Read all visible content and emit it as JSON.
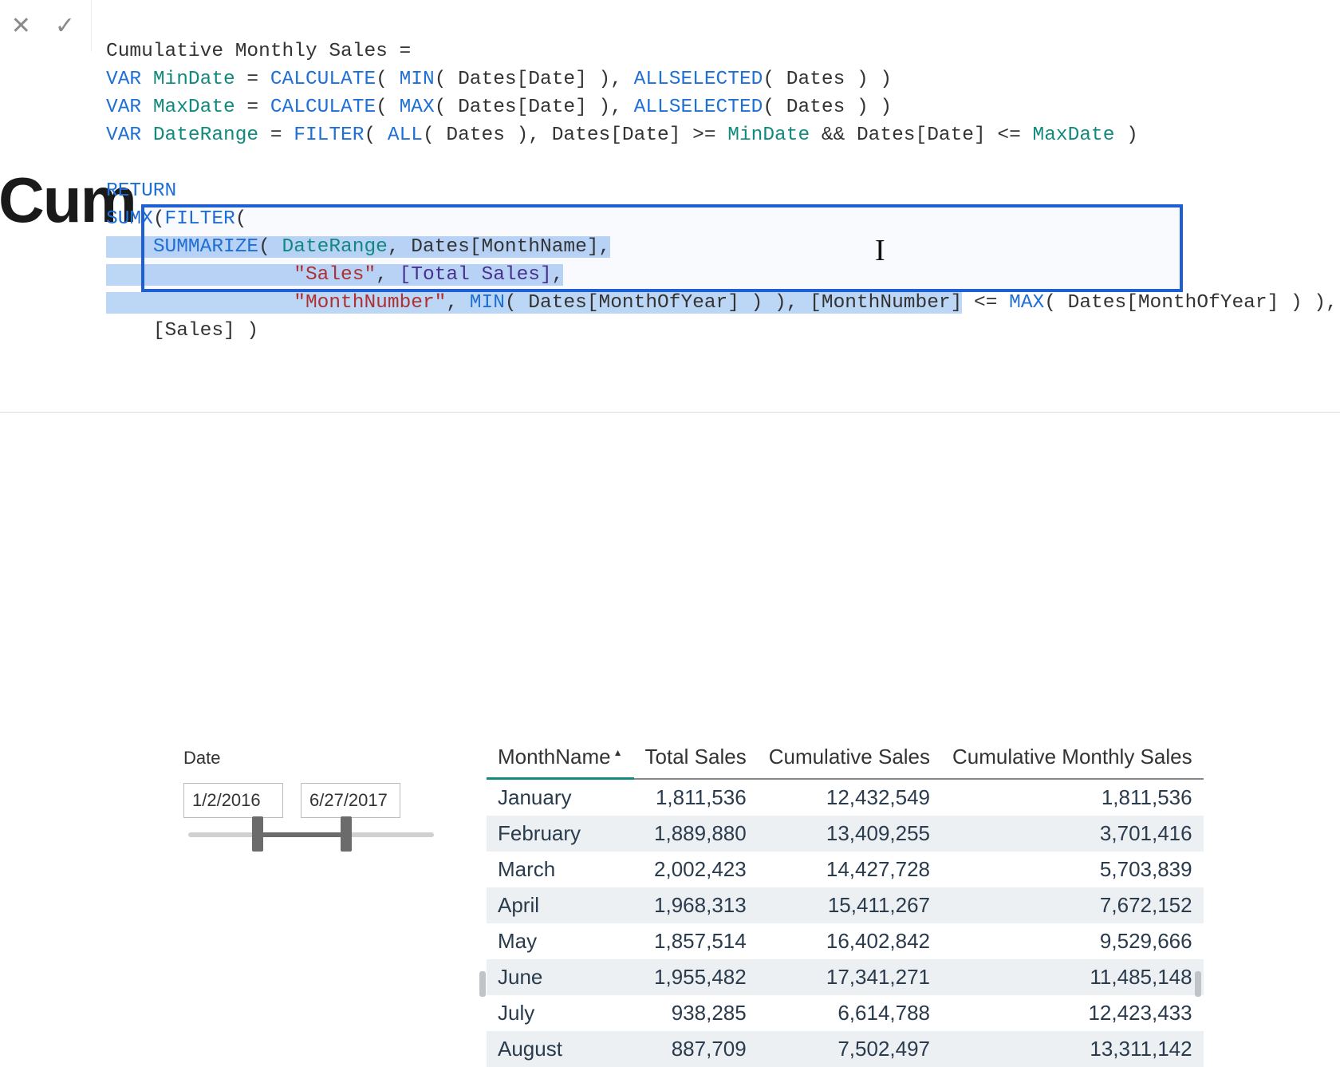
{
  "title_fragment": "Cum",
  "formula": {
    "line1": "Cumulative Monthly Sales =",
    "l2_pre": "VAR ",
    "l2_name": "MinDate",
    "l2_eq": " = ",
    "l2_fn1": "CALCULATE",
    "l2_mid1": "( ",
    "l2_fn2": "MIN",
    "l2_mid2": "( Dates[Date] ), ",
    "l2_fn3": "ALLSELECTED",
    "l2_end": "( Dates ) )",
    "l3_pre": "VAR ",
    "l3_name": "MaxDate",
    "l3_eq": " = ",
    "l3_fn1": "CALCULATE",
    "l3_mid1": "( ",
    "l3_fn2": "MAX",
    "l3_mid2": "( Dates[Date] ), ",
    "l3_fn3": "ALLSELECTED",
    "l3_end": "( Dates ) )",
    "l4_pre": "VAR ",
    "l4_name": "DateRange",
    "l4_eq": " = ",
    "l4_fn1": "FILTER",
    "l4_mid1": "( ",
    "l4_fn2": "ALL",
    "l4_mid2": "( Dates ), Dates[Date] >= ",
    "l4_v1": "MinDate",
    "l4_mid3": " && Dates[Date] <= ",
    "l4_v2": "MaxDate",
    "l4_end": " )",
    "l5_blank": " ",
    "l6": "RETURN",
    "l7_fn1": "SUMX",
    "l7_mid": "(",
    "l7_fn2": "FILTER",
    "l7_end": "(",
    "l8_indent": "    ",
    "l8_fn": "SUMMARIZE",
    "l8_mid1": "( ",
    "l8_var": "DateRange",
    "l8_mid2": ", Dates[MonthName],",
    "l9_indent": "                ",
    "l9_str": "\"Sales\"",
    "l9_mid": ", ",
    "l9_meas": "[Total Sales]",
    "l9_end": ",",
    "l10_indent": "                ",
    "l10_str": "\"MonthNumber\"",
    "l10_mid1": ", ",
    "l10_fn1": "MIN",
    "l10_mid2": "( Dates[MonthOfYear] ) ), [MonthNumber]",
    "l10_mid3": " <= ",
    "l10_fn2": "MAX",
    "l10_end": "( Dates[MonthOfYear] ) ),",
    "l11_indent": "    ",
    "l11_txt": "[Sales] )"
  },
  "slicer": {
    "label": "Date",
    "from": "1/2/2016",
    "to": "6/27/2017"
  },
  "table": {
    "columns": [
      "MonthName",
      "Total Sales",
      "Cumulative Sales",
      "Cumulative Monthly Sales"
    ],
    "rows": [
      [
        "January",
        "1,811,536",
        "12,432,549",
        "1,811,536"
      ],
      [
        "February",
        "1,889,880",
        "13,409,255",
        "3,701,416"
      ],
      [
        "March",
        "2,002,423",
        "14,427,728",
        "5,703,839"
      ],
      [
        "April",
        "1,968,313",
        "15,411,267",
        "7,672,152"
      ],
      [
        "May",
        "1,857,514",
        "16,402,842",
        "9,529,666"
      ],
      [
        "June",
        "1,955,482",
        "17,341,271",
        "11,485,148"
      ],
      [
        "July",
        "938,285",
        "6,614,788",
        "12,423,433"
      ],
      [
        "August",
        "887,709",
        "7,502,497",
        "13,311,142"
      ]
    ]
  },
  "chart_data": {
    "type": "table",
    "columns": [
      "MonthName",
      "Total Sales",
      "Cumulative Sales",
      "Cumulative Monthly Sales"
    ],
    "rows": [
      {
        "MonthName": "January",
        "Total Sales": 1811536,
        "Cumulative Sales": 12432549,
        "Cumulative Monthly Sales": 1811536
      },
      {
        "MonthName": "February",
        "Total Sales": 1889880,
        "Cumulative Sales": 13409255,
        "Cumulative Monthly Sales": 3701416
      },
      {
        "MonthName": "March",
        "Total Sales": 2002423,
        "Cumulative Sales": 14427728,
        "Cumulative Monthly Sales": 5703839
      },
      {
        "MonthName": "April",
        "Total Sales": 1968313,
        "Cumulative Sales": 15411267,
        "Cumulative Monthly Sales": 7672152
      },
      {
        "MonthName": "May",
        "Total Sales": 1857514,
        "Cumulative Sales": 16402842,
        "Cumulative Monthly Sales": 9529666
      },
      {
        "MonthName": "June",
        "Total Sales": 1955482,
        "Cumulative Sales": 17341271,
        "Cumulative Monthly Sales": 11485148
      },
      {
        "MonthName": "July",
        "Total Sales": 938285,
        "Cumulative Sales": 6614788,
        "Cumulative Monthly Sales": 12423433
      },
      {
        "MonthName": "August",
        "Total Sales": 887709,
        "Cumulative Sales": 7502497,
        "Cumulative Monthly Sales": 13311142
      }
    ]
  }
}
